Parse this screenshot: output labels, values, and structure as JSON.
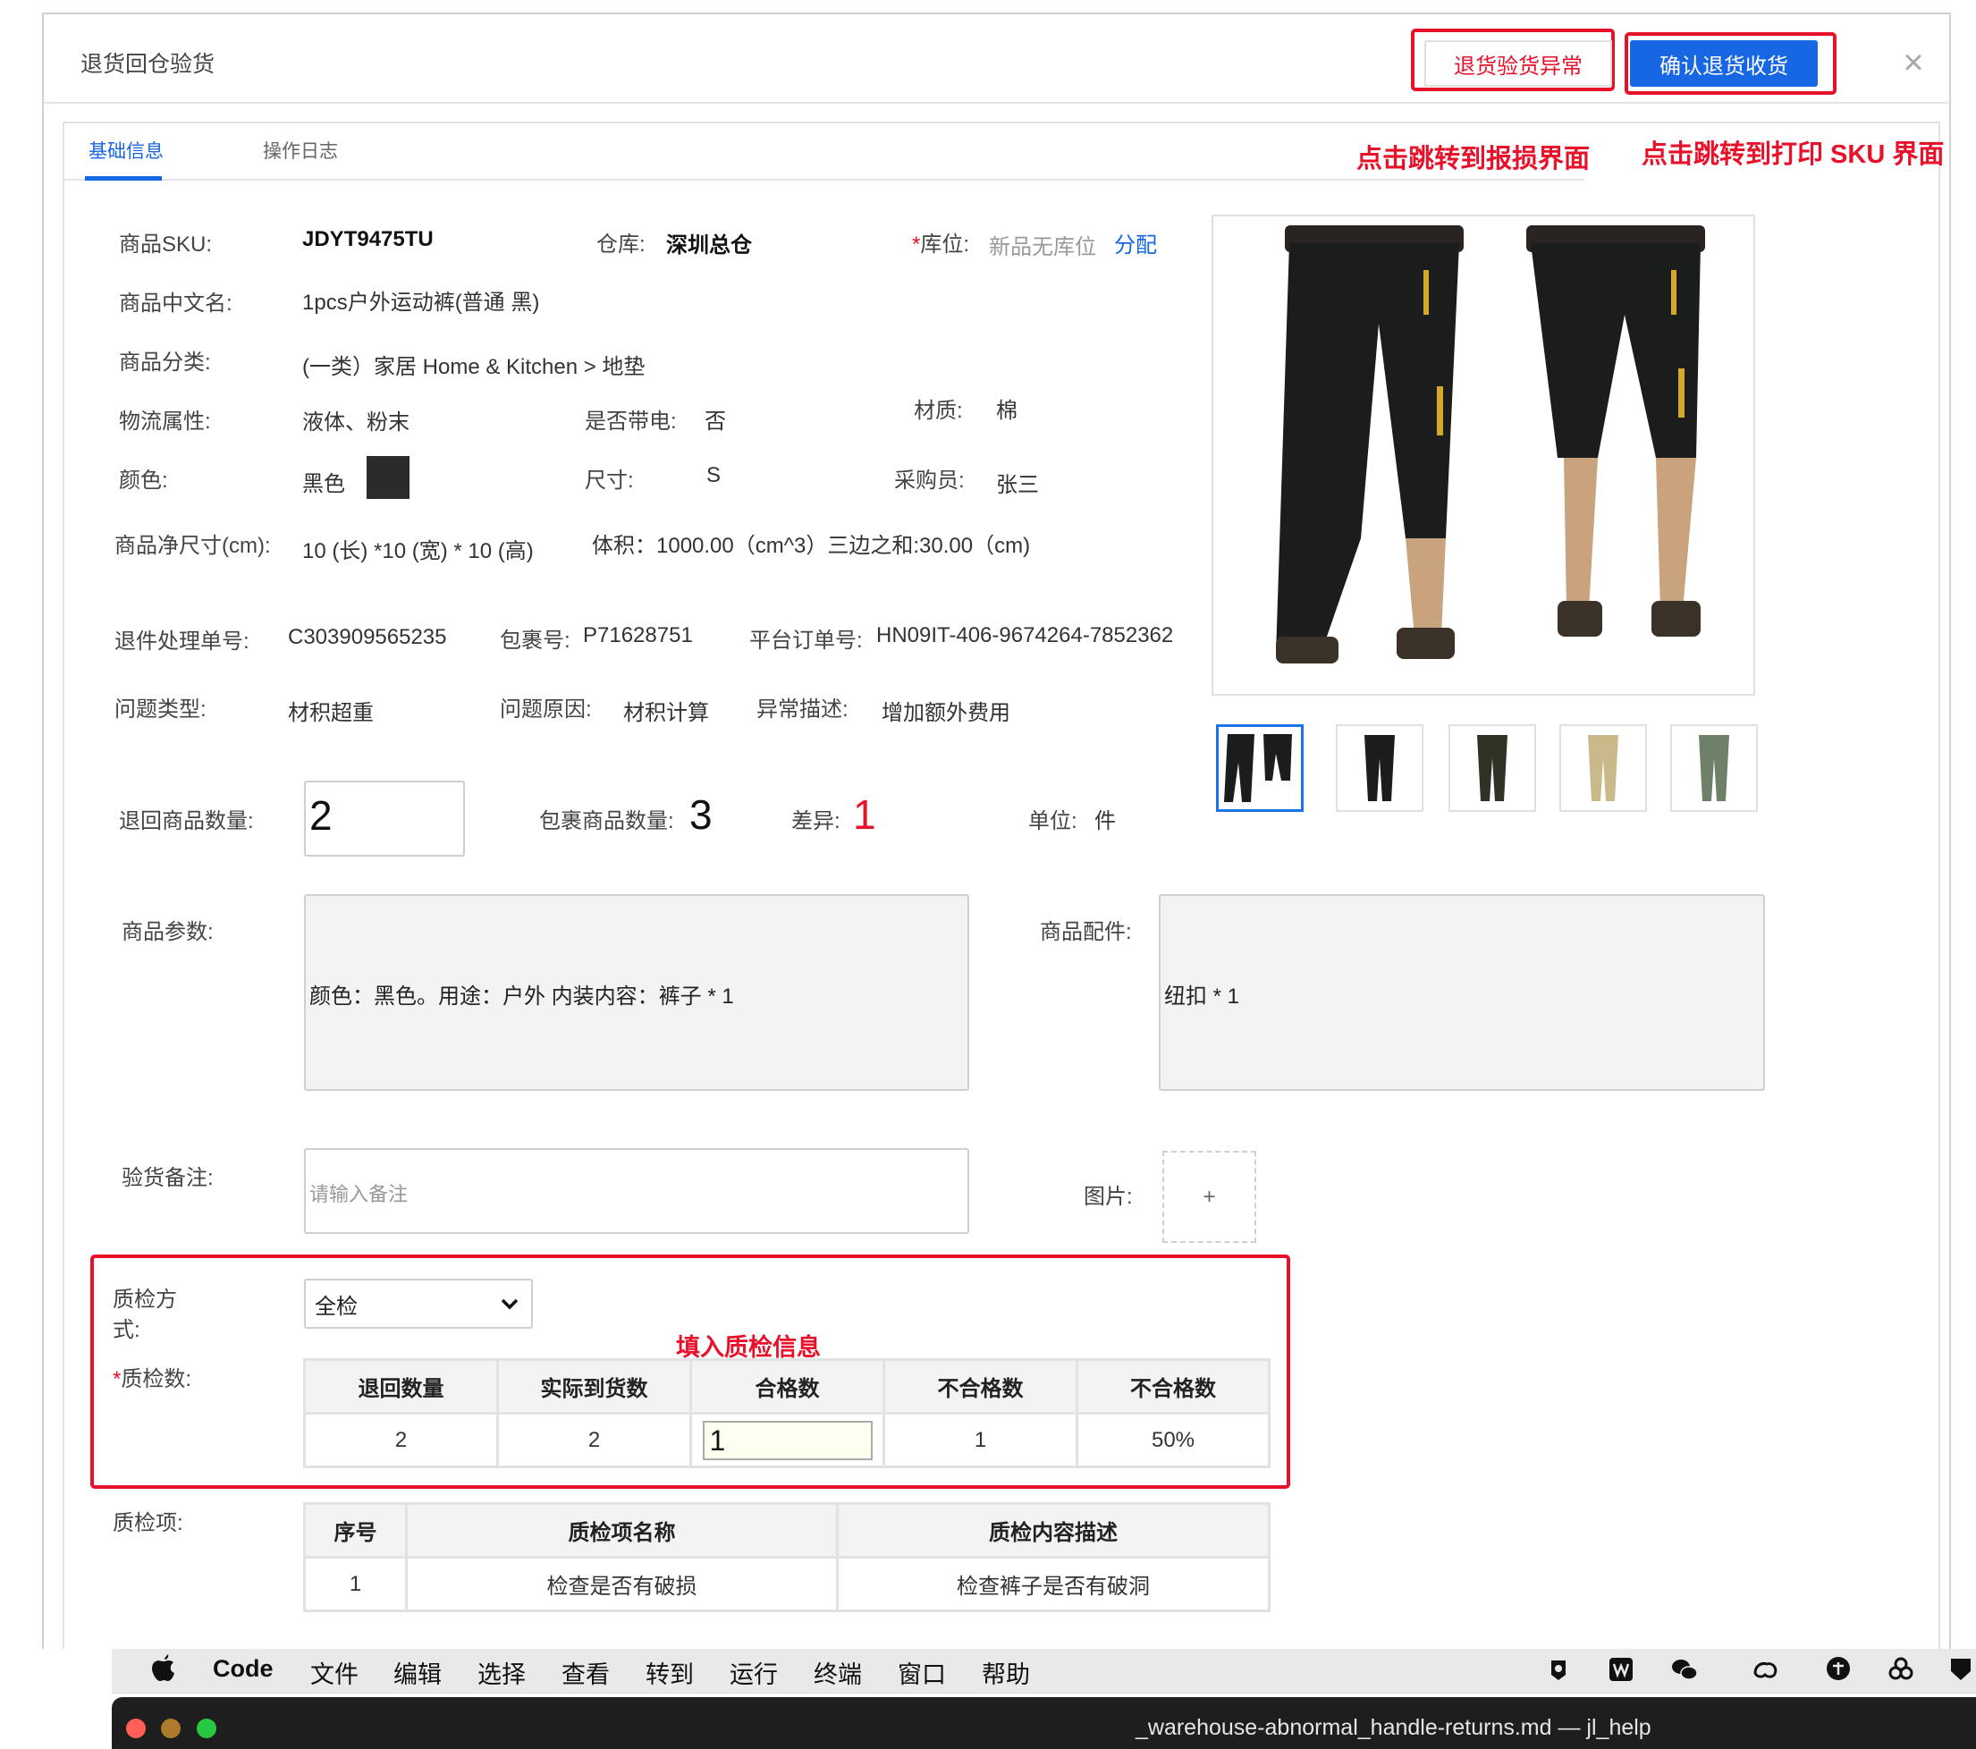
{
  "dialog": {
    "title": "退货回仓验货"
  },
  "actions": {
    "abnormal_label": "退货验货异常",
    "confirm_label": "确认退货收货",
    "close_glyph": "×"
  },
  "tabs": [
    {
      "label": "基础信息"
    },
    {
      "label": "操作日志"
    }
  ],
  "notes": {
    "abnormal": "点击跳转到报损界面",
    "confirm": "点击跳转到打印 SKU 界面",
    "qc": "填入质检信息"
  },
  "product": {
    "sku_label": "商品SKU:",
    "sku": "JDYT9475TU",
    "warehouse_label": "仓库:",
    "warehouse": "深圳总仓",
    "location_req": "*",
    "location_label": "库位:",
    "location": "新品无库位",
    "assign_label": "分配",
    "cn_name_label": "商品中文名:",
    "cn_name": "1pcs户外运动裤(普通 黑)",
    "category_label": "商品分类:",
    "category": "(一类）家居 Home & Kitchen  >  地垫",
    "logistics_label": "物流属性:",
    "logistics": "液体、粉末",
    "electric_label": "是否带电:",
    "electric": "否",
    "material_label": "材质:",
    "material": "棉",
    "color_label": "颜色:",
    "color": "黑色",
    "color_swatch_hex": "#2b2b2b",
    "size_label": "尺寸:",
    "size": "S",
    "buyer_label": "采购员:",
    "buyer": "张三",
    "net_size_label": "商品净尺寸(cm):",
    "net_size": "10 (长) *10 (宽) * 10 (高)",
    "volume": "体积：1000.00（cm^3）三边之和:30.00（cm)"
  },
  "return_info": {
    "ticket_label": "退件处理单号:",
    "ticket": "C303909565235",
    "package_label": "包裹号:",
    "package": "P71628751",
    "platform_label": "平台订单号:",
    "platform_order": "HN09IT-406-9674264-7852362",
    "issue_type_label": "问题类型:",
    "issue_type": "材积超重",
    "issue_reason_label": "问题原因:",
    "issue_reason": "材积计算",
    "abnormal_desc_label": "异常描述:",
    "abnormal_desc": "增加额外费用"
  },
  "quantities": {
    "returned_label": "退回商品数量:",
    "returned": "2",
    "package_qty_label": "包裹商品数量:",
    "package_qty": "3",
    "diff_label": "差异:",
    "diff": "1",
    "unit_label": "单位:",
    "unit": "件"
  },
  "params": {
    "label": "商品参数:",
    "value": "颜色：黑色。用途：户外    内装内容：裤子 * 1"
  },
  "accessories": {
    "label": "商品配件:",
    "value": "纽扣 * 1"
  },
  "remark": {
    "label": "验货备注:",
    "placeholder": "请输入备注"
  },
  "images": {
    "label": "图片:",
    "upload_glyph": "+"
  },
  "qc": {
    "method_label": "质检方式:",
    "method": "全检",
    "count_req": "*",
    "count_label": "质检数:",
    "headers": [
      "退回数量",
      "实际到货数",
      "合格数",
      "不合格数",
      "不合格数"
    ],
    "row": {
      "returned": "2",
      "actual": "2",
      "passed": "1",
      "failed": "1",
      "failed_rate": "50%"
    },
    "items_label": "质检项:",
    "items_headers": [
      "序号",
      "质检项名称",
      "质检内容描述"
    ],
    "items": [
      {
        "no": "1",
        "name": "检查是否有破损",
        "desc": "检查裤子是否有破洞"
      }
    ]
  },
  "menubar": {
    "app": "Code",
    "items": [
      "文件",
      "编辑",
      "选择",
      "查看",
      "转到",
      "运行",
      "终端",
      "窗口",
      "帮助"
    ]
  },
  "window": {
    "title": "_warehouse-abnormal_handle-returns.md — jl_help"
  }
}
